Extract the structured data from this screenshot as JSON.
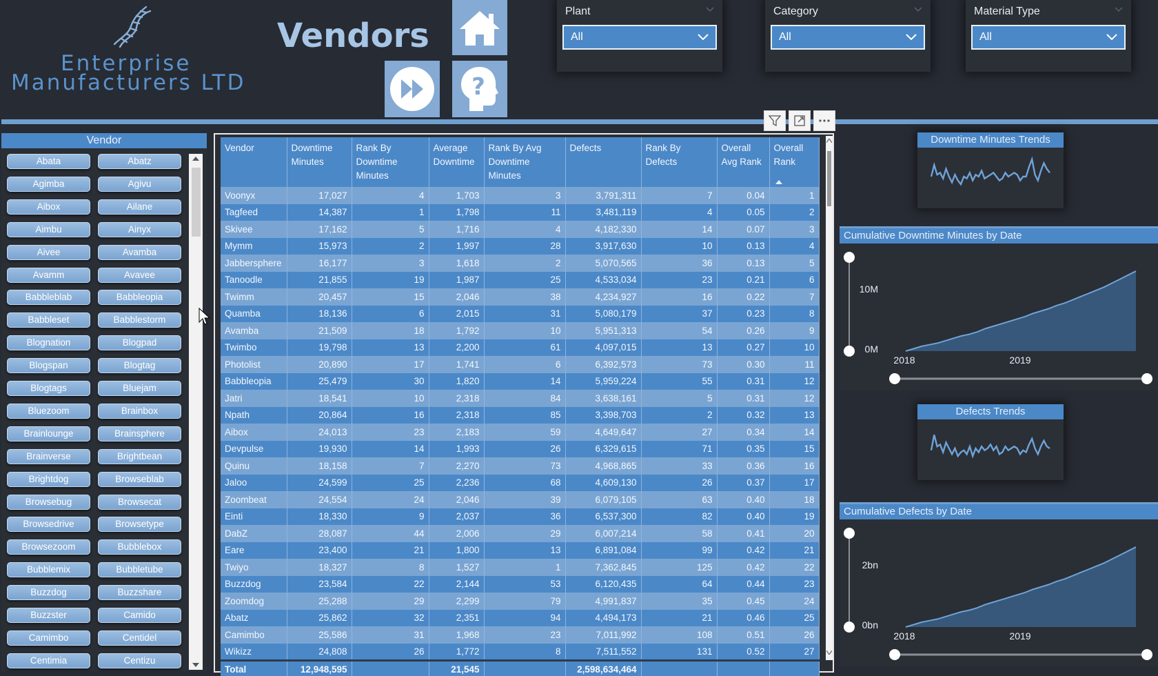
{
  "header": {
    "logo_line1": "Enterprise",
    "logo_line2": "Manufacturers LTD",
    "title": "Vendors"
  },
  "nav": {
    "home_icon": "home-icon",
    "forward_icon": "fast-forward-icon",
    "help_icon": "help-icon"
  },
  "slicers": {
    "plant": {
      "label": "Plant",
      "value": "All"
    },
    "category": {
      "label": "Category",
      "value": "All"
    },
    "material_type": {
      "label": "Material Type",
      "value": "All"
    }
  },
  "vendor_slicer": {
    "header": "Vendor",
    "items": [
      "Abata",
      "Abatz",
      "Agimba",
      "Agivu",
      "Aibox",
      "Ailane",
      "Aimbu",
      "Ainyx",
      "Aivee",
      "Avamba",
      "Avamm",
      "Avavee",
      "Babbleblab",
      "Babbleopia",
      "Babbleset",
      "Babblestorm",
      "Blognation",
      "Blogpad",
      "Blogspan",
      "Blogtag",
      "Blogtags",
      "Bluejam",
      "Bluezoom",
      "Brainbox",
      "Brainlounge",
      "Brainsphere",
      "Brainverse",
      "Brightbean",
      "Brightdog",
      "Browseblab",
      "Browsebug",
      "Browsecat",
      "Browsedrive",
      "Browsetype",
      "Browsezoom",
      "Bubblebox",
      "Bubblemix",
      "Bubbletube",
      "Buzzdog",
      "Buzzshare",
      "Buzzster",
      "Camido",
      "Camimbo",
      "Centidel",
      "Centimia",
      "Centizu"
    ]
  },
  "table": {
    "columns": [
      "Vendor",
      "Downtime Minutes",
      "Rank By Downtime Minutes",
      "Average Downtime",
      "Rank By Avg Downtime Minutes",
      "Defects",
      "Rank By Defects",
      "Overall Avg Rank",
      "Overall Rank"
    ],
    "rows": [
      [
        "Voonyx",
        "17,027",
        "4",
        "1,703",
        "3",
        "3,791,311",
        "7",
        "0.04",
        "1"
      ],
      [
        "Tagfeed",
        "14,387",
        "1",
        "1,798",
        "11",
        "3,481,119",
        "4",
        "0.05",
        "2"
      ],
      [
        "Skivee",
        "17,162",
        "5",
        "1,716",
        "4",
        "4,182,330",
        "14",
        "0.07",
        "3"
      ],
      [
        "Mymm",
        "15,973",
        "2",
        "1,997",
        "28",
        "3,917,630",
        "10",
        "0.13",
        "4"
      ],
      [
        "Jabbersphere",
        "16,177",
        "3",
        "1,618",
        "2",
        "5,070,565",
        "36",
        "0.13",
        "5"
      ],
      [
        "Tanoodle",
        "21,855",
        "19",
        "1,987",
        "25",
        "4,533,034",
        "23",
        "0.21",
        "6"
      ],
      [
        "Twimm",
        "20,457",
        "15",
        "2,046",
        "38",
        "4,234,927",
        "16",
        "0.22",
        "7"
      ],
      [
        "Quamba",
        "18,136",
        "6",
        "2,015",
        "31",
        "5,080,179",
        "37",
        "0.23",
        "8"
      ],
      [
        "Avamba",
        "21,509",
        "18",
        "1,792",
        "10",
        "5,951,313",
        "54",
        "0.26",
        "9"
      ],
      [
        "Twimbo",
        "19,798",
        "13",
        "2,200",
        "61",
        "4,097,015",
        "13",
        "0.27",
        "10"
      ],
      [
        "Photolist",
        "20,890",
        "17",
        "1,741",
        "6",
        "6,392,573",
        "73",
        "0.30",
        "11"
      ],
      [
        "Babbleopia",
        "25,479",
        "30",
        "1,820",
        "14",
        "5,959,224",
        "55",
        "0.31",
        "12"
      ],
      [
        "Jatri",
        "18,541",
        "10",
        "2,318",
        "84",
        "3,638,161",
        "5",
        "0.31",
        "12"
      ],
      [
        "Npath",
        "20,864",
        "16",
        "2,318",
        "85",
        "3,398,703",
        "2",
        "0.32",
        "13"
      ],
      [
        "Aibox",
        "24,013",
        "23",
        "2,183",
        "59",
        "4,649,647",
        "27",
        "0.34",
        "14"
      ],
      [
        "Devpulse",
        "19,930",
        "14",
        "1,993",
        "26",
        "6,329,615",
        "71",
        "0.35",
        "15"
      ],
      [
        "Quinu",
        "18,158",
        "7",
        "2,270",
        "73",
        "4,968,865",
        "33",
        "0.36",
        "16"
      ],
      [
        "Jaloo",
        "24,599",
        "25",
        "2,236",
        "68",
        "4,609,130",
        "26",
        "0.37",
        "17"
      ],
      [
        "Zoombeat",
        "24,554",
        "24",
        "2,046",
        "39",
        "6,079,105",
        "63",
        "0.40",
        "18"
      ],
      [
        "Einti",
        "18,330",
        "9",
        "2,037",
        "36",
        "6,537,300",
        "82",
        "0.40",
        "19"
      ],
      [
        "DabZ",
        "28,087",
        "44",
        "2,006",
        "29",
        "6,007,214",
        "58",
        "0.41",
        "20"
      ],
      [
        "Eare",
        "23,400",
        "21",
        "1,800",
        "13",
        "6,891,084",
        "99",
        "0.42",
        "21"
      ],
      [
        "Twiyo",
        "18,327",
        "8",
        "1,527",
        "1",
        "7,362,845",
        "125",
        "0.42",
        "22"
      ],
      [
        "Buzzdog",
        "23,584",
        "22",
        "2,144",
        "53",
        "6,120,435",
        "64",
        "0.44",
        "23"
      ],
      [
        "Zoomdog",
        "25,288",
        "29",
        "2,299",
        "79",
        "4,991,837",
        "35",
        "0.45",
        "24"
      ],
      [
        "Abatz",
        "25,862",
        "32",
        "2,351",
        "94",
        "4,494,173",
        "21",
        "0.46",
        "25"
      ],
      [
        "Camimbo",
        "25,586",
        "31",
        "1,968",
        "23",
        "7,011,992",
        "108",
        "0.51",
        "26"
      ],
      [
        "Wikizz",
        "24,808",
        "26",
        "1,772",
        "8",
        "7,511,552",
        "131",
        "0.52",
        "27"
      ]
    ],
    "total": [
      "Total",
      "12,948,595",
      "",
      "21,545",
      "",
      "2,598,634,464",
      "",
      "",
      ""
    ]
  },
  "charts": {
    "downtime_trends_title": "Downtime Minutes Trends",
    "defects_trends_title": "Defects Trends",
    "cum_downtime_title": "Cumulative Downtime Minutes by Date",
    "cum_defects_title": "Cumulative Defects by Date",
    "cum_downtime_yticks": [
      "10M",
      "0M"
    ],
    "cum_defects_yticks": [
      "2bn",
      "0bn"
    ],
    "xticks": [
      "2018",
      "2019"
    ]
  },
  "chart_data": [
    {
      "type": "line",
      "title": "Downtime Minutes Trends",
      "x": [
        0,
        1,
        2,
        3,
        4,
        5,
        6,
        7,
        8,
        9,
        10,
        11,
        12,
        13,
        14,
        15,
        16,
        17,
        18,
        19,
        20,
        21,
        22,
        23,
        24,
        25,
        26,
        27,
        28,
        29,
        30,
        31,
        32,
        33,
        34,
        35,
        36,
        37,
        38,
        39,
        40
      ],
      "values": [
        0.5,
        0.8,
        0.55,
        0.6,
        0.45,
        0.7,
        0.5,
        0.35,
        0.55,
        0.4,
        0.3,
        0.5,
        0.45,
        0.6,
        0.4,
        0.55,
        0.5,
        0.65,
        0.45,
        0.5,
        0.55,
        0.6,
        0.5,
        0.4,
        0.45,
        0.6,
        0.5,
        0.55,
        0.6,
        0.55,
        0.4,
        0.5,
        0.5,
        0.75,
        0.95,
        0.55,
        0.4,
        0.65,
        0.85,
        0.7,
        0.6
      ]
    },
    {
      "type": "line",
      "title": "Defects Trends",
      "x": [
        0,
        1,
        2,
        3,
        4,
        5,
        6,
        7,
        8,
        9,
        10,
        11,
        12,
        13,
        14,
        15,
        16,
        17,
        18,
        19,
        20,
        21,
        22,
        23,
        24,
        25,
        26,
        27,
        28,
        29,
        30,
        31,
        32,
        33,
        34,
        35,
        36,
        37,
        38,
        39,
        40
      ],
      "values": [
        0.45,
        0.85,
        0.55,
        0.6,
        0.4,
        0.65,
        0.5,
        0.35,
        0.5,
        0.3,
        0.4,
        0.45,
        0.35,
        0.55,
        0.3,
        0.5,
        0.4,
        0.55,
        0.45,
        0.5,
        0.6,
        0.45,
        0.55,
        0.35,
        0.4,
        0.55,
        0.45,
        0.5,
        0.55,
        0.5,
        0.35,
        0.45,
        0.4,
        0.6,
        0.75,
        0.5,
        0.35,
        0.55,
        0.7,
        0.55,
        0.5
      ]
    },
    {
      "type": "area",
      "title": "Cumulative Downtime Minutes by Date",
      "x": [
        "2018",
        "2019"
      ],
      "ylim": [
        0,
        12948595
      ],
      "values": [
        0,
        0.03,
        0.06,
        0.08,
        0.1,
        0.13,
        0.16,
        0.19,
        0.21,
        0.24,
        0.28,
        0.31,
        0.34,
        0.37,
        0.4,
        0.43,
        0.47,
        0.5,
        0.53,
        0.57,
        0.6,
        0.64,
        0.68,
        0.72,
        0.76,
        0.8,
        0.85,
        0.9,
        0.95,
        1.0
      ]
    },
    {
      "type": "area",
      "title": "Cumulative Defects by Date",
      "x": [
        "2018",
        "2019"
      ],
      "ylim": [
        0,
        2598634464
      ],
      "values": [
        0,
        0.03,
        0.06,
        0.08,
        0.1,
        0.13,
        0.16,
        0.19,
        0.21,
        0.24,
        0.28,
        0.31,
        0.34,
        0.37,
        0.4,
        0.43,
        0.47,
        0.5,
        0.53,
        0.57,
        0.6,
        0.64,
        0.68,
        0.72,
        0.76,
        0.8,
        0.85,
        0.9,
        0.95,
        1.0
      ]
    }
  ],
  "colors": {
    "accent": "#4b88c8",
    "row_light": "#7aa5d3",
    "background": "#272b33",
    "header_text": "#a7c6e6"
  }
}
